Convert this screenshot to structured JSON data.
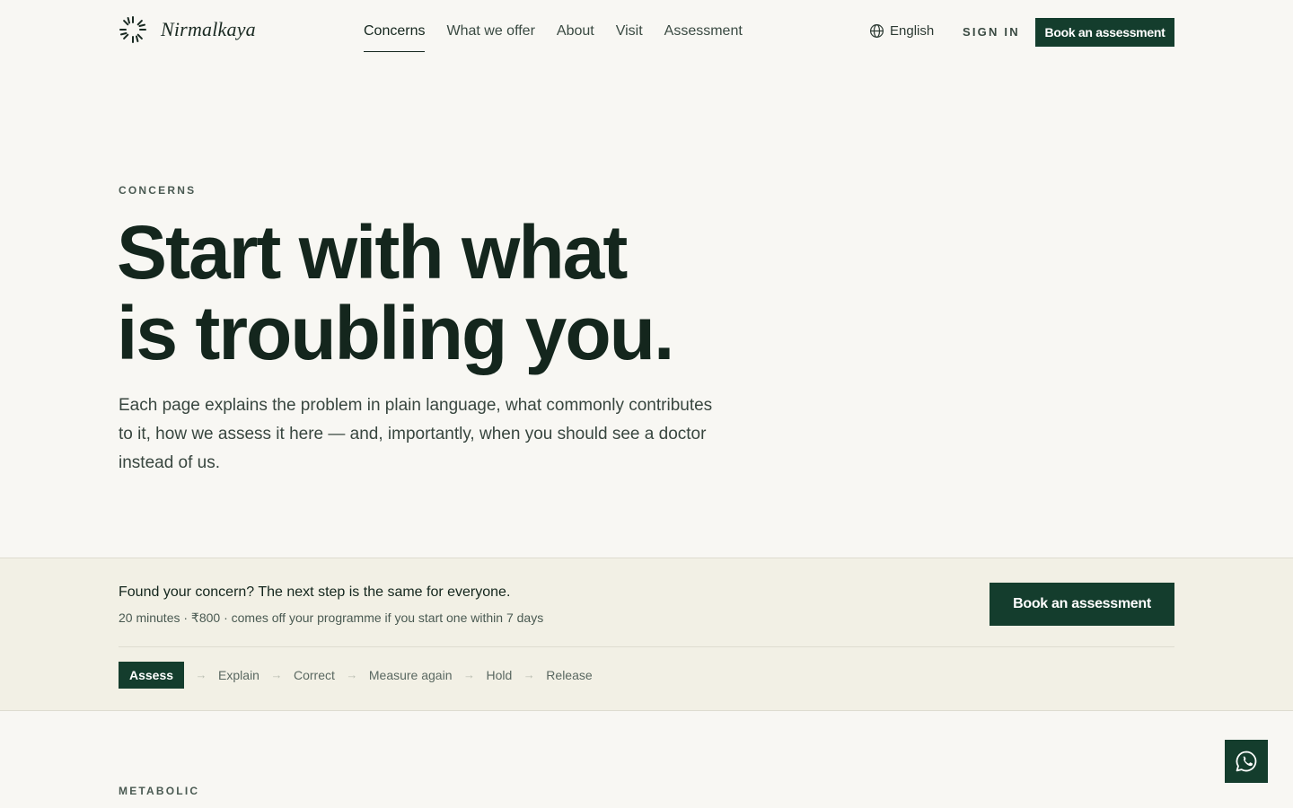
{
  "brand": {
    "name": "Nirmalkaya"
  },
  "nav": {
    "items": [
      {
        "label": "Concerns",
        "active": true
      },
      {
        "label": "What we offer",
        "active": false
      },
      {
        "label": "About",
        "active": false
      },
      {
        "label": "Visit",
        "active": false
      },
      {
        "label": "Assessment",
        "active": false
      }
    ]
  },
  "header": {
    "language": "English",
    "signin": "SIGN IN",
    "cta": "Book an assessment"
  },
  "hero": {
    "eyebrow": "CONCERNS",
    "title_line1": "Start with what",
    "title_line2": "is troubling you.",
    "body": "Each page explains the problem in plain language, what commonly contributes to it, how we assess it here — and, importantly, when you should see a doctor instead of us."
  },
  "band": {
    "title": "Found your concern? The next step is the same for everyone.",
    "subtitle": "20 minutes · ₹800 · comes off your programme if you start one within 7 days",
    "cta": "Book an assessment",
    "steps": [
      {
        "label": "Assess",
        "active": true
      },
      {
        "label": "Explain",
        "active": false
      },
      {
        "label": "Correct",
        "active": false
      },
      {
        "label": "Measure again",
        "active": false
      },
      {
        "label": "Hold",
        "active": false
      },
      {
        "label": "Release",
        "active": false
      }
    ],
    "arrow": "→"
  },
  "next_section": {
    "label": "METABOLIC"
  },
  "colors": {
    "background": "#f8f7f3",
    "band": "#f2f0e5",
    "primary": "#143d2d",
    "text": "#14261d"
  },
  "icons": {
    "logo": "sunburst-logo-icon",
    "language": "globe-icon",
    "chat": "whatsapp-icon"
  }
}
